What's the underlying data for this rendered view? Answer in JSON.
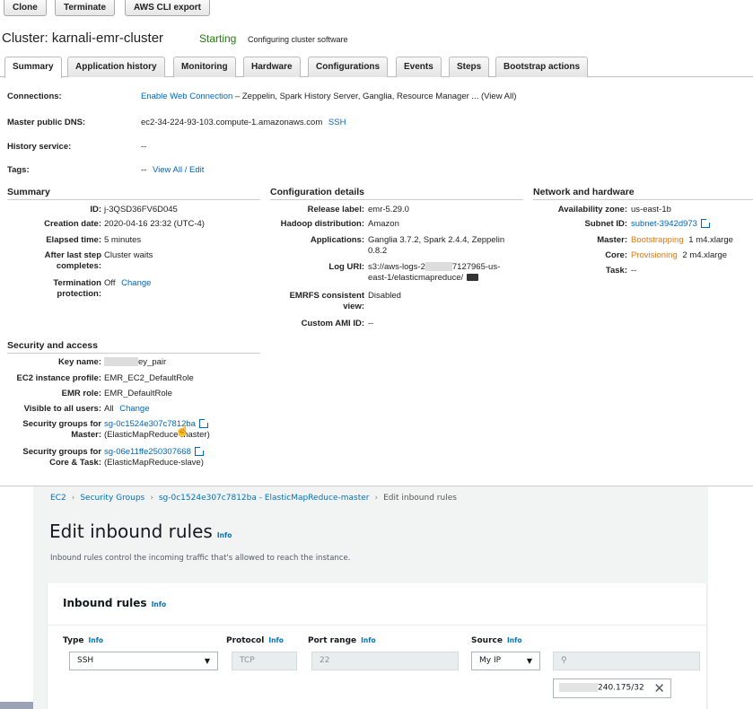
{
  "toolbar": {
    "clone": "Clone",
    "terminate": "Terminate",
    "cli_export": "AWS CLI export"
  },
  "cluster": {
    "title": "Cluster: karnali-emr-cluster",
    "status": "Starting",
    "status_detail": "Configuring cluster software"
  },
  "tabs": [
    "Summary",
    "Application history",
    "Monitoring",
    "Hardware",
    "Configurations",
    "Events",
    "Steps",
    "Bootstrap actions"
  ],
  "top_fields": {
    "connections_label": "Connections:",
    "connections_link": "Enable Web Connection",
    "connections_rest": " – Zeppelin, Spark History Server, Ganglia, Resource Manager ... (View All)",
    "dns_label": "Master public DNS:",
    "dns_value": "ec2-34-224-93-103.compute-1.amazonaws.com",
    "dns_ssh": "SSH",
    "history_label": "History service:",
    "history_value": "--",
    "tags_label": "Tags:",
    "tags_dash": "--",
    "tags_link": "View All / Edit"
  },
  "summary": {
    "heading": "Summary",
    "id_l": "ID:",
    "id_v": "j-3QSD36FV6D045",
    "created_l": "Creation date:",
    "created_v": "2020-04-16 23:32 (UTC-4)",
    "elapsed_l": "Elapsed time:",
    "elapsed_v": "5 minutes",
    "after_l1": "After last step",
    "after_l2": "completes:",
    "after_v": "Cluster waits",
    "term_l1": "Termination",
    "term_l2": "protection:",
    "term_v": "Off",
    "term_change": "Change"
  },
  "config": {
    "heading": "Configuration details",
    "release_l": "Release label:",
    "release_v": "emr-5.29.0",
    "hadoop_l": "Hadoop distribution:",
    "hadoop_v": "Amazon",
    "apps_l": "Applications:",
    "apps_v1": "Ganglia 3.7.2, Spark 2.4.4, Zeppelin",
    "apps_v2": "0.8.2",
    "log_l": "Log URI:",
    "log_v1a": "s3://aws-logs-2",
    "log_v1b": "7127965-us-",
    "log_v2": "east-1/elasticmapreduce/",
    "emrfs_l1": "EMRFS consistent",
    "emrfs_l2": "view:",
    "emrfs_v": "Disabled",
    "ami_l": "Custom AMI ID:",
    "ami_v": "--"
  },
  "network": {
    "heading": "Network and hardware",
    "az_l": "Availability zone:",
    "az_v": "us-east-1b",
    "subnet_l": "Subnet ID:",
    "subnet_v": "subnet-3942d973",
    "master_l": "Master:",
    "master_status": "Bootstrapping",
    "master_v": "1  m4.xlarge",
    "core_l": "Core:",
    "core_status": "Provisioning",
    "core_v": "2  m4.xlarge",
    "task_l": "Task:",
    "task_v": "--"
  },
  "security": {
    "heading": "Security and access",
    "key_l": "Key name:",
    "key_v": "ey_pair",
    "profile_l": "EC2 instance profile:",
    "profile_v": "EMR_EC2_DefaultRole",
    "role_l": "EMR role:",
    "role_v": "EMR_DefaultRole",
    "visible_l": "Visible to all users:",
    "visible_v": "All",
    "visible_change": "Change",
    "sg_master_l1": "Security groups for",
    "sg_master_l2": "Master:",
    "sg_master_link": "sg-0c1524e307c7812ba",
    "sg_master_name": "(ElasticMapReduce-master)",
    "sg_core_l1": "Security groups for",
    "sg_core_l2": "Core & Task:",
    "sg_core_link": "sg-06e11ffe250307668",
    "sg_core_name": "(ElasticMapReduce-slave)"
  },
  "ec2": {
    "crumbs": [
      "EC2",
      "Security Groups",
      "sg-0c1524e307c7812ba - ElasticMapReduce-master",
      "Edit inbound rules"
    ],
    "title": "Edit inbound rules",
    "info": "Info",
    "desc": "Inbound rules control the incoming traffic that's allowed to reach the instance.",
    "panel_title": "Inbound rules",
    "col_type": "Type",
    "col_protocol": "Protocol",
    "col_port": "Port range",
    "col_source": "Source",
    "type_value": "SSH",
    "protocol_value": "TCP",
    "port_value": "22",
    "source_value": "My IP",
    "cidr_value": "240.175/32"
  },
  "icons": [
    "caret-down-icon",
    "search-icon",
    "close-icon",
    "external-link-icon",
    "folder-icon",
    "hand-cursor-icon"
  ]
}
